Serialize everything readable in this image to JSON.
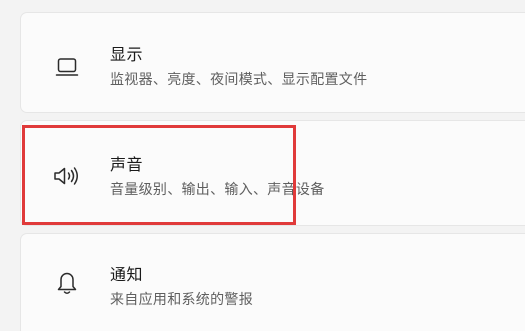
{
  "settings": {
    "items": [
      {
        "title": "显示",
        "description": "监视器、亮度、夜间模式、显示配置文件",
        "icon": "monitor-icon"
      },
      {
        "title": "声音",
        "description": "音量级别、输出、输入、声音设备",
        "icon": "speaker-icon"
      },
      {
        "title": "通知",
        "description": "来自应用和系统的警报",
        "icon": "bell-icon"
      }
    ]
  },
  "highlight": {
    "color": "#e03a3a",
    "target": "sound-setting-card"
  }
}
